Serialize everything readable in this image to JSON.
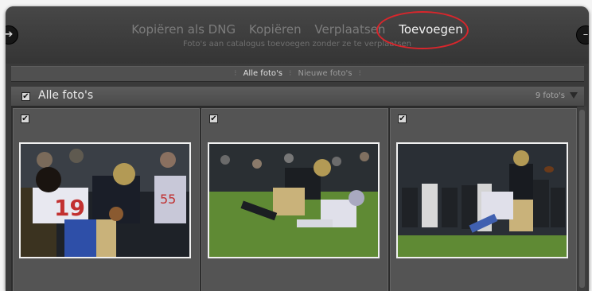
{
  "topbar": {
    "modes": [
      {
        "label": "Kopiëren als DNG",
        "active": false
      },
      {
        "label": "Kopiëren",
        "active": false
      },
      {
        "label": "Verplaatsen",
        "active": false
      },
      {
        "label": "Toevoegen",
        "active": true
      }
    ],
    "mode_description": "Foto's aan catalogus toevoegen zonder ze te verplaatsen",
    "highlight_color": "#d8262c"
  },
  "filter": {
    "options": [
      {
        "label": "Alle foto's",
        "active": true
      },
      {
        "label": "Nieuwe foto's",
        "active": false
      }
    ]
  },
  "section": {
    "check": "✔",
    "title": "Alle foto's",
    "count": "9 foto's"
  },
  "photos": [
    {
      "check": "✔",
      "scene": "football-tackle-closeup"
    },
    {
      "check": "✔",
      "scene": "football-tackle-on-field"
    },
    {
      "check": "✔",
      "scene": "football-player-running"
    }
  ],
  "icons": {
    "left": "arrow-left-icon",
    "right": "arrow-right-icon"
  }
}
